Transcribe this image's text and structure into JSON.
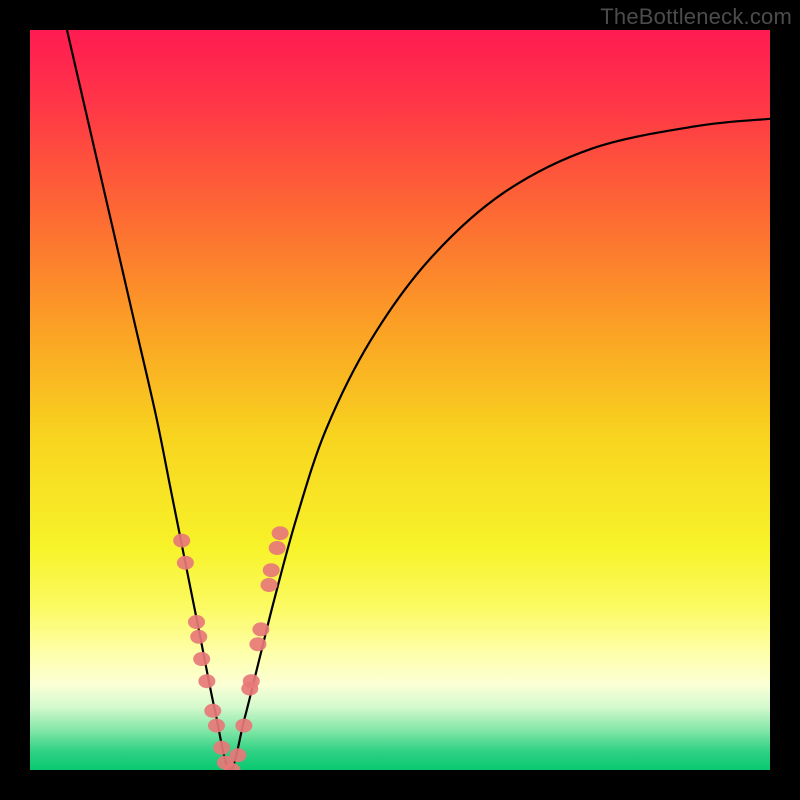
{
  "watermark": "TheBottleneck.com",
  "colors": {
    "frame": "#000000",
    "watermark": "#4c4c4c",
    "dot": "rgba(231,120,120,0.92)",
    "curve": "#000000",
    "gradient_stops": [
      {
        "offset": 0.0,
        "color": "#ff1b52"
      },
      {
        "offset": 0.1,
        "color": "#ff3647"
      },
      {
        "offset": 0.25,
        "color": "#fd6a33"
      },
      {
        "offset": 0.4,
        "color": "#fba025"
      },
      {
        "offset": 0.55,
        "color": "#f8d41f"
      },
      {
        "offset": 0.7,
        "color": "#f7f32a"
      },
      {
        "offset": 0.78,
        "color": "#fbfa62"
      },
      {
        "offset": 0.84,
        "color": "#feffa8"
      },
      {
        "offset": 0.885,
        "color": "#fbffd5"
      },
      {
        "offset": 0.915,
        "color": "#d3f9cd"
      },
      {
        "offset": 0.945,
        "color": "#86e7a9"
      },
      {
        "offset": 0.975,
        "color": "#2fd183"
      },
      {
        "offset": 1.0,
        "color": "#08c971"
      }
    ]
  },
  "chart_data": {
    "type": "line",
    "title": "",
    "xlabel": "",
    "ylabel": "",
    "xlim": [
      0,
      100
    ],
    "ylim": [
      0,
      100
    ],
    "grid": false,
    "notes": "V-shaped bottleneck curve. x is implicit relative position (0-100), y is bottleneck percent (0 optimal, 100 worst). Minimum at x≈27 y≈0.",
    "series": [
      {
        "name": "bottleneck-curve",
        "x": [
          5,
          8,
          11,
          14,
          17,
          19,
          21,
          23,
          25,
          27,
          29,
          31,
          33,
          36,
          40,
          46,
          54,
          64,
          76,
          90,
          100
        ],
        "y": [
          100,
          87,
          74,
          61,
          48,
          38,
          28,
          18,
          8,
          0,
          7,
          15,
          23,
          34,
          46,
          58,
          69,
          78,
          84,
          87,
          88
        ]
      }
    ],
    "scatter_overlay": {
      "name": "sample-dots",
      "points": [
        {
          "x": 20.5,
          "y": 31
        },
        {
          "x": 21.0,
          "y": 28
        },
        {
          "x": 22.5,
          "y": 20
        },
        {
          "x": 22.8,
          "y": 18
        },
        {
          "x": 23.2,
          "y": 15
        },
        {
          "x": 23.9,
          "y": 12
        },
        {
          "x": 24.7,
          "y": 8
        },
        {
          "x": 25.2,
          "y": 6
        },
        {
          "x": 25.9,
          "y": 3
        },
        {
          "x": 26.4,
          "y": 1
        },
        {
          "x": 27.3,
          "y": 0
        },
        {
          "x": 28.1,
          "y": 2
        },
        {
          "x": 28.9,
          "y": 6
        },
        {
          "x": 29.7,
          "y": 11
        },
        {
          "x": 29.9,
          "y": 12
        },
        {
          "x": 30.8,
          "y": 17
        },
        {
          "x": 31.2,
          "y": 19
        },
        {
          "x": 32.3,
          "y": 25
        },
        {
          "x": 32.6,
          "y": 27
        },
        {
          "x": 33.4,
          "y": 30
        },
        {
          "x": 33.8,
          "y": 32
        }
      ]
    }
  }
}
